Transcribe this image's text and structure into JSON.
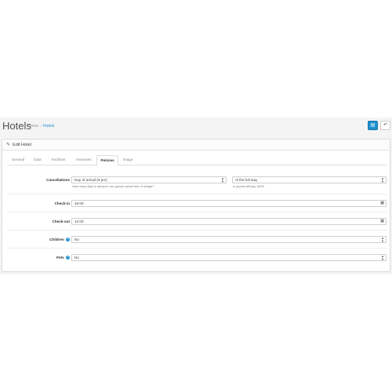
{
  "page": {
    "title": "Hotels",
    "breadcrumb": [
      {
        "label": "Home"
      },
      {
        "label": "Hotels"
      }
    ],
    "breadcrumb_separator": "›",
    "save_icon": "save-icon",
    "back_icon": "reply-icon",
    "accent_color": "#1e91cf"
  },
  "panel": {
    "heading": "Edit Hotel"
  },
  "tabs": [
    {
      "label": "General",
      "active": false
    },
    {
      "label": "Data",
      "active": false
    },
    {
      "label": "Facilities",
      "active": false
    },
    {
      "label": "Amenities",
      "active": false
    },
    {
      "label": "Policies",
      "active": true
    },
    {
      "label": "Image",
      "active": false
    }
  ],
  "form": {
    "cancellations": {
      "label": "Cancellations",
      "select_value": "Day of arrival (6 pm)",
      "select_hint": "How many days in advance can guests cancel free of charge?",
      "penalty_value": "of the full stay",
      "penalty_hint": "or guests will pay 100%"
    },
    "checkin": {
      "label": "Check-in",
      "value": "15:00"
    },
    "checkout": {
      "label": "Check-out",
      "value": "12:00"
    },
    "children": {
      "label": "Children",
      "value": "No"
    },
    "pets": {
      "label": "Pets",
      "value": "No"
    }
  }
}
